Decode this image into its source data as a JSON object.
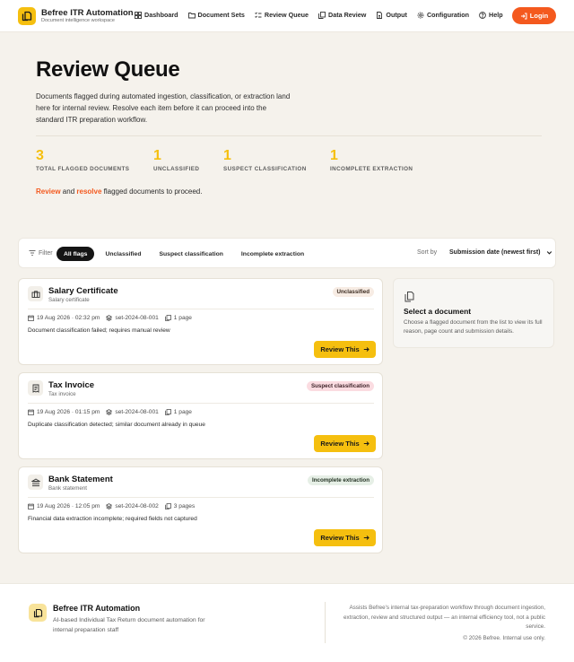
{
  "header": {
    "brand_name": "Befree ITR Automation",
    "brand_sub": "Document intelligence workspace",
    "nav": [
      {
        "label": "Dashboard",
        "icon": "grid-icon"
      },
      {
        "label": "Document Sets",
        "icon": "folder-icon"
      },
      {
        "label": "Review Queue",
        "icon": "list-check-icon"
      },
      {
        "label": "Data Review",
        "icon": "copy-icon"
      },
      {
        "label": "Output",
        "icon": "file-icon"
      },
      {
        "label": "Configuration",
        "icon": "gear-icon"
      },
      {
        "label": "Help",
        "icon": "help-circle-icon"
      }
    ],
    "login_label": "Login"
  },
  "hero": {
    "title": "Review Queue",
    "description": "Documents flagged during automated ingestion, classification, or extraction land here for internal review. Resolve each item before it can proceed into the standard ITR preparation workflow.",
    "stats": [
      {
        "value": "3",
        "label": "TOTAL FLAGGED DOCUMENTS"
      },
      {
        "value": "1",
        "label": "UNCLASSIFIED"
      },
      {
        "value": "1",
        "label": "SUSPECT CLASSIFICATION"
      },
      {
        "value": "1",
        "label": "INCOMPLETE EXTRACTION"
      }
    ],
    "note_review": "Review",
    "note_and": " and ",
    "note_resolve": "resolve",
    "note_rest": " flagged documents to proceed."
  },
  "filters": {
    "label": "Filter",
    "chips": [
      "All flags",
      "Unclassified",
      "Suspect classification",
      "Incomplete extraction"
    ],
    "active_index": 0,
    "sort_label": "Sort by",
    "sort_value": "Submission date (newest first)"
  },
  "cards": [
    {
      "title": "Salary Certificate",
      "subtitle": "Salary certificate",
      "icon": "briefcase-icon",
      "badge": "Unclassified",
      "badge_type": "unclassified",
      "date": "19 Aug 2026 · 02:32 pm",
      "set": "set-2024-08-001",
      "pages": "1 page",
      "reason": "Document classification failed; requires manual review",
      "button": "Review This"
    },
    {
      "title": "Tax Invoice",
      "subtitle": "Tax invoice",
      "icon": "receipt-icon",
      "badge": "Suspect classification",
      "badge_type": "suspect",
      "date": "19 Aug 2026 · 01:15 pm",
      "set": "set-2024-08-001",
      "pages": "1 page",
      "reason": "Duplicate classification detected; similar document already in queue",
      "button": "Review This"
    },
    {
      "title": "Bank Statement",
      "subtitle": "Bank statement",
      "icon": "bank-icon",
      "badge": "Incomplete extraction",
      "badge_type": "incomplete",
      "date": "19 Aug 2026 · 12:05 pm",
      "set": "set-2024-08-002",
      "pages": "3 pages",
      "reason": "Financial data extraction incomplete; required fields not captured",
      "button": "Review This"
    }
  ],
  "side_panel": {
    "title": "Select a document",
    "description": "Choose a flagged document from the list to view its full reason, page count and submission details."
  },
  "footer": {
    "name": "Befree ITR Automation",
    "description": "AI-based Individual Tax Return document automation for internal preparation staff",
    "right_text": "Assists Befree's internal tax-preparation workflow through document ingestion, extraction, review and structured output — an internal efficiency tool, not a public service.",
    "copyright": "© 2026 Befree. Internal use only."
  },
  "colors": {
    "accent_yellow": "#f5bf0f",
    "accent_orange": "#f4591e",
    "background": "#f5f2ec"
  }
}
